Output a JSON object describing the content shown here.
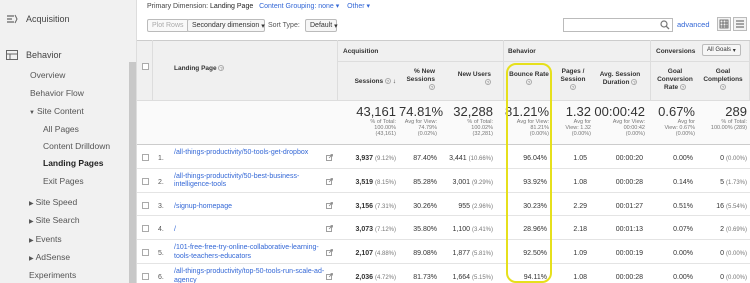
{
  "sidebar": {
    "acquisition": "Acquisition",
    "behavior": "Behavior",
    "items": [
      {
        "label": "Overview"
      },
      {
        "label": "Behavior Flow"
      },
      {
        "label": "Site Content"
      },
      {
        "label": "All Pages"
      },
      {
        "label": "Content Drilldown"
      },
      {
        "label": "Landing Pages"
      },
      {
        "label": "Exit Pages"
      },
      {
        "label": "Site Speed"
      },
      {
        "label": "Site Search"
      },
      {
        "label": "Events"
      },
      {
        "label": "AdSense"
      },
      {
        "label": "Experiments"
      }
    ]
  },
  "toolbar": {
    "primary_label": "Primary Dimension:",
    "primary_value": "Landing Page",
    "content_grouping": "Content Grouping:",
    "content_grouping_value": "none",
    "other": "Other",
    "plot_rows": "Plot Rows",
    "secondary_dimension": "Secondary dimension",
    "sort_type_label": "Sort Type:",
    "sort_type_value": "Default",
    "advanced": "advanced"
  },
  "table": {
    "landing_page_header": "Landing Page",
    "groups": {
      "acquisition": "Acquisition",
      "behavior": "Behavior",
      "conversions": "Conversions",
      "goals": "All Goals"
    },
    "columns": {
      "sessions": "Sessions",
      "new_sessions": "% New Sessions",
      "new_users": "New Users",
      "bounce": "Bounce Rate",
      "pages": "Pages / Session",
      "duration": "Avg. Session Duration",
      "conv_rate": "Goal Conversion Rate",
      "completions": "Goal Completions"
    },
    "totals": {
      "sessions": {
        "big": "43,161",
        "l1": "% of Total:",
        "l2": "100.00%",
        "l3": "(43,161)"
      },
      "new_sessions": {
        "big": "74.81%",
        "l1": "Avg for View:",
        "l2": "74.79%",
        "l3": "(0.02%)"
      },
      "new_users": {
        "big": "32,288",
        "l1": "% of Total:",
        "l2": "100.02%",
        "l3": "(32,281)"
      },
      "bounce": {
        "big": "81.21%",
        "l1": "Avg for View:",
        "l2": "81.21%",
        "l3": "(0.00%)"
      },
      "pages": {
        "big": "1.32",
        "l1": "Avg for",
        "l2": "View: 1.32",
        "l3": "(0.00%)"
      },
      "duration": {
        "big": "00:00:42",
        "l1": "Avg for View:",
        "l2": "00:00:42",
        "l3": "(0.00%)"
      },
      "conv_rate": {
        "big": "0.67%",
        "l1": "Avg for",
        "l2": "View: 0.67%",
        "l3": "(0.00%)"
      },
      "completions": {
        "big": "289",
        "l1": "% of Total:",
        "l2": "100.00% (289)",
        "l3": ""
      }
    },
    "rows": [
      {
        "n": "1.",
        "page": "/all-things-productivity/50-tools-get-dropbox",
        "sessions": "3,937",
        "sessions_pct": "(9.12%)",
        "new_sessions": "87.40%",
        "new_users": "3,441",
        "new_users_pct": "(10.66%)",
        "bounce": "96.04%",
        "pages": "1.05",
        "duration": "00:00:20",
        "conv": "0.00%",
        "comp": "0",
        "comp_pct": "(0.00%)"
      },
      {
        "n": "2.",
        "page": "/all-things-productivity/50-best-business-intelligence-tools",
        "sessions": "3,519",
        "sessions_pct": "(8.15%)",
        "new_sessions": "85.28%",
        "new_users": "3,001",
        "new_users_pct": "(9.29%)",
        "bounce": "93.92%",
        "pages": "1.08",
        "duration": "00:00:28",
        "conv": "0.14%",
        "comp": "5",
        "comp_pct": "(1.73%)"
      },
      {
        "n": "3.",
        "page": "/signup-homepage",
        "sessions": "3,156",
        "sessions_pct": "(7.31%)",
        "new_sessions": "30.26%",
        "new_users": "955",
        "new_users_pct": "(2.96%)",
        "bounce": "30.23%",
        "pages": "2.29",
        "duration": "00:01:27",
        "conv": "0.51%",
        "comp": "16",
        "comp_pct": "(5.54%)"
      },
      {
        "n": "4.",
        "page": "/",
        "sessions": "3,073",
        "sessions_pct": "(7.12%)",
        "new_sessions": "35.80%",
        "new_users": "1,100",
        "new_users_pct": "(3.41%)",
        "bounce": "28.96%",
        "pages": "2.18",
        "duration": "00:01:13",
        "conv": "0.07%",
        "comp": "2",
        "comp_pct": "(0.69%)"
      },
      {
        "n": "5.",
        "page": "/101-free-free-try-online-collaborative-learning-tools-teachers-educators",
        "sessions": "2,107",
        "sessions_pct": "(4.88%)",
        "new_sessions": "89.08%",
        "new_users": "1,877",
        "new_users_pct": "(5.81%)",
        "bounce": "92.50%",
        "pages": "1.09",
        "duration": "00:00:19",
        "conv": "0.00%",
        "comp": "0",
        "comp_pct": "(0.00%)"
      },
      {
        "n": "6.",
        "page": "/all-things-productivity/top-50-tools-run-scale-ad-agency",
        "sessions": "2,036",
        "sessions_pct": "(4.72%)",
        "new_sessions": "81.73%",
        "new_users": "1,664",
        "new_users_pct": "(5.15%)",
        "bounce": "94.11%",
        "pages": "1.08",
        "duration": "00:00:28",
        "conv": "0.00%",
        "comp": "0",
        "comp_pct": "(0.00%)"
      }
    ]
  },
  "colors": {
    "link": "#3367d6",
    "highlight": "#e6e01c"
  }
}
